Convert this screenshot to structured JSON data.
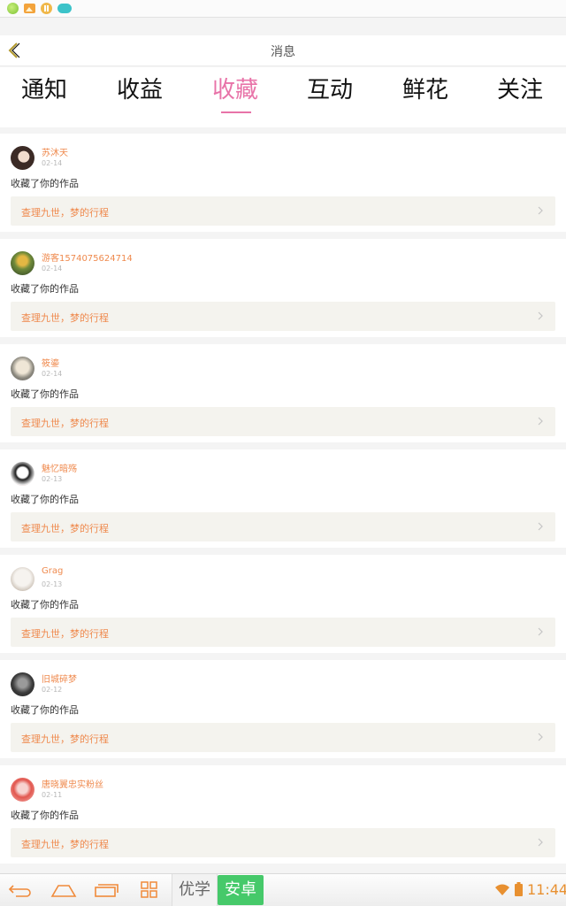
{
  "header": {
    "title": "消息"
  },
  "tabs": [
    {
      "label": "通知"
    },
    {
      "label": "收益"
    },
    {
      "label": "收藏",
      "active": true
    },
    {
      "label": "互动"
    },
    {
      "label": "鲜花"
    },
    {
      "label": "关注"
    }
  ],
  "items": [
    {
      "name": "苏沐天",
      "date": "02-14",
      "action": "收藏了你的作品",
      "work": "查理九世，梦的行程"
    },
    {
      "name": "游客1574075624714",
      "date": "02-14",
      "action": "收藏了你的作品",
      "work": "查理九世，梦的行程"
    },
    {
      "name": "筱鎏",
      "date": "02-14",
      "action": "收藏了你的作品",
      "work": "查理九世，梦的行程"
    },
    {
      "name": "魅忆暗殇",
      "date": "02-13",
      "action": "收藏了你的作品",
      "work": "查理九世，梦的行程"
    },
    {
      "name": "Grag",
      "date": "02-13",
      "action": "收藏了你的作品",
      "work": "查理九世，梦的行程"
    },
    {
      "name": "旧城碎梦",
      "date": "02-12",
      "action": "收藏了你的作品",
      "work": "查理九世，梦的行程"
    },
    {
      "name": "唐晓翼忠实粉丝",
      "date": "02-11",
      "action": "收藏了你的作品",
      "work": "查理九世，梦的行程"
    }
  ],
  "navbar": {
    "brand_left": "优学",
    "brand_right": "安卓",
    "time": "11:44"
  },
  "colors": {
    "accent_pink": "#e873a8",
    "accent_orange": "#ef8a4e",
    "brand_green": "#46c96a"
  }
}
